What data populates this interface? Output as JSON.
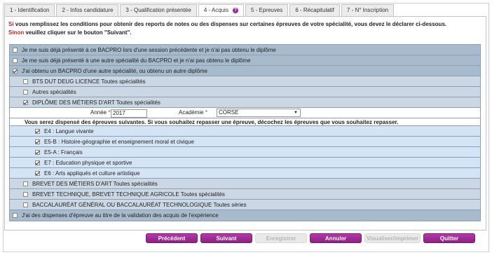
{
  "tabs": [
    {
      "label": "1 - Identification",
      "active": false
    },
    {
      "label": "2 - Infos candidature",
      "active": false
    },
    {
      "label": "3 - Qualification présentée",
      "active": false
    },
    {
      "label": "4 - Acquis",
      "active": true,
      "has_info_icon": true
    },
    {
      "label": "5 - Epreuves",
      "active": false
    },
    {
      "label": "6 - Récapitulatif",
      "active": false
    },
    {
      "label": "7 - N° Inscription",
      "active": false
    }
  ],
  "intro": {
    "line1_prefix": "Si",
    "line1_rest": " vous remplissez les conditions pour obtenir des reports de notes ou des dispenses sur certaines épreuves de votre spécialité, vous devez le déclarer ci-dessous.",
    "line2_prefix": "Sinon",
    "line2_rest": " veuillez cliquer sur le bouton \"Suivant\"."
  },
  "options": {
    "opt1": {
      "label": "Je me suis déjà présenté à ce BACPRO lors d'une session précédente et je n'ai pas obtenu le diplôme",
      "checked": false
    },
    "opt2": {
      "label": "Je me suis déjà présenté à une autre spécialité du BACPRO et je n'ai pas obtenu le diplôme",
      "checked": false
    },
    "opt3": {
      "label": "J'ai obtenu un BACPRO d'une autre spécialité, ou obtenu un autre diplôme",
      "checked": true
    },
    "opt4": {
      "label": "J'ai des dispenses d'épreuve au titre de la validation des acquis de l'expérience",
      "checked": false
    }
  },
  "diplomas": {
    "bts": {
      "label": "BTS DUT DEUG LICENCE Toutes spécialités",
      "checked": false
    },
    "autres": {
      "label": "Autres spécialités",
      "checked": false
    },
    "dma": {
      "label": "DIPLÔME DES MÉTIERS D'ART Toutes spécialités",
      "checked": true
    },
    "bma": {
      "label": "BREVET DES MÉTIERS D'ART Toutes spécialités",
      "checked": false
    },
    "bta": {
      "label": "BREVET TECHNIQUE, BREVET TECHNIQUE AGRICOLE Toutes spécialités",
      "checked": false
    },
    "bac": {
      "label": "BACCALAURÉAT GÉNÉRAL OU BACCALAURÉAT TECHNOLOGIQUE Toutes séries",
      "checked": false
    }
  },
  "fields": {
    "annee_label": "Année",
    "annee_value": "2017",
    "academie_label": "Académie",
    "academie_value": "CORSE",
    "required_mark": "*"
  },
  "dispense_notice": "Vous serez dispensé des épreuves suivantes. Si vous souhaitez repasser une épreuve, décochez les épreuves que vous souhaitez repasser.",
  "epreuves": {
    "e4": {
      "label": "E4 : Langue vivante",
      "checked": true
    },
    "e5b": {
      "label": "E5-B : Histoire-géographie et enseignement moral et civique",
      "checked": true
    },
    "e5a": {
      "label": "E5-A : Français",
      "checked": true
    },
    "e7": {
      "label": "E7 : Education physique et sportive",
      "checked": true
    },
    "e6": {
      "label": "E6 : Arts appliqués et culture artistique",
      "checked": true
    }
  },
  "buttons": {
    "precedent": {
      "label": "Précédent",
      "enabled": true
    },
    "suivant": {
      "label": "Suivant",
      "enabled": true
    },
    "enregistrer": {
      "label": "Enregistrer",
      "enabled": false
    },
    "annuler": {
      "label": "Annuler",
      "enabled": true
    },
    "visualiser": {
      "label": "Visualiser/imprimer",
      "enabled": false
    },
    "quitter": {
      "label": "Quitter",
      "enabled": true
    }
  },
  "colors": {
    "accent": "#a0279a",
    "required": "#c62828",
    "row_top": "#a7bbcc",
    "row_level2": "#cbd7e2",
    "row_level3": "#d5e4f5"
  }
}
